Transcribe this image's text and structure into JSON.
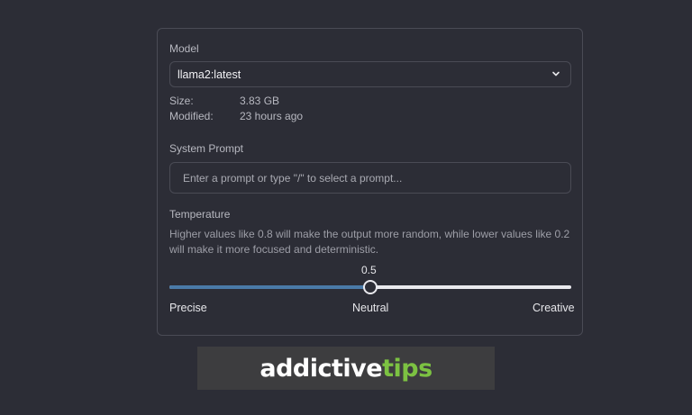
{
  "model": {
    "label": "Model",
    "selected": "llama2:latest",
    "size_label": "Size:",
    "size_value": "3.83 GB",
    "modified_label": "Modified:",
    "modified_value": "23 hours ago"
  },
  "system_prompt": {
    "label": "System Prompt",
    "placeholder": "Enter a prompt or type \"/\" to select a prompt..."
  },
  "temperature": {
    "label": "Temperature",
    "description": "Higher values like 0.8 will make the output more random, while lower values like 0.2 will make it more focused and deterministic.",
    "value": "0.5",
    "fraction": 0.5,
    "min_label": "Precise",
    "mid_label": "Neutral",
    "max_label": "Creative"
  },
  "watermark": {
    "part1": "addictive",
    "part2": "tips",
    "colors": {
      "primary": "#ffffff",
      "accent": "#7cc242"
    }
  },
  "colors": {
    "background": "#2c2d36",
    "slider_fill": "#4a7aa8"
  },
  "icons": {
    "select_chevron": "chevron-down-icon"
  }
}
